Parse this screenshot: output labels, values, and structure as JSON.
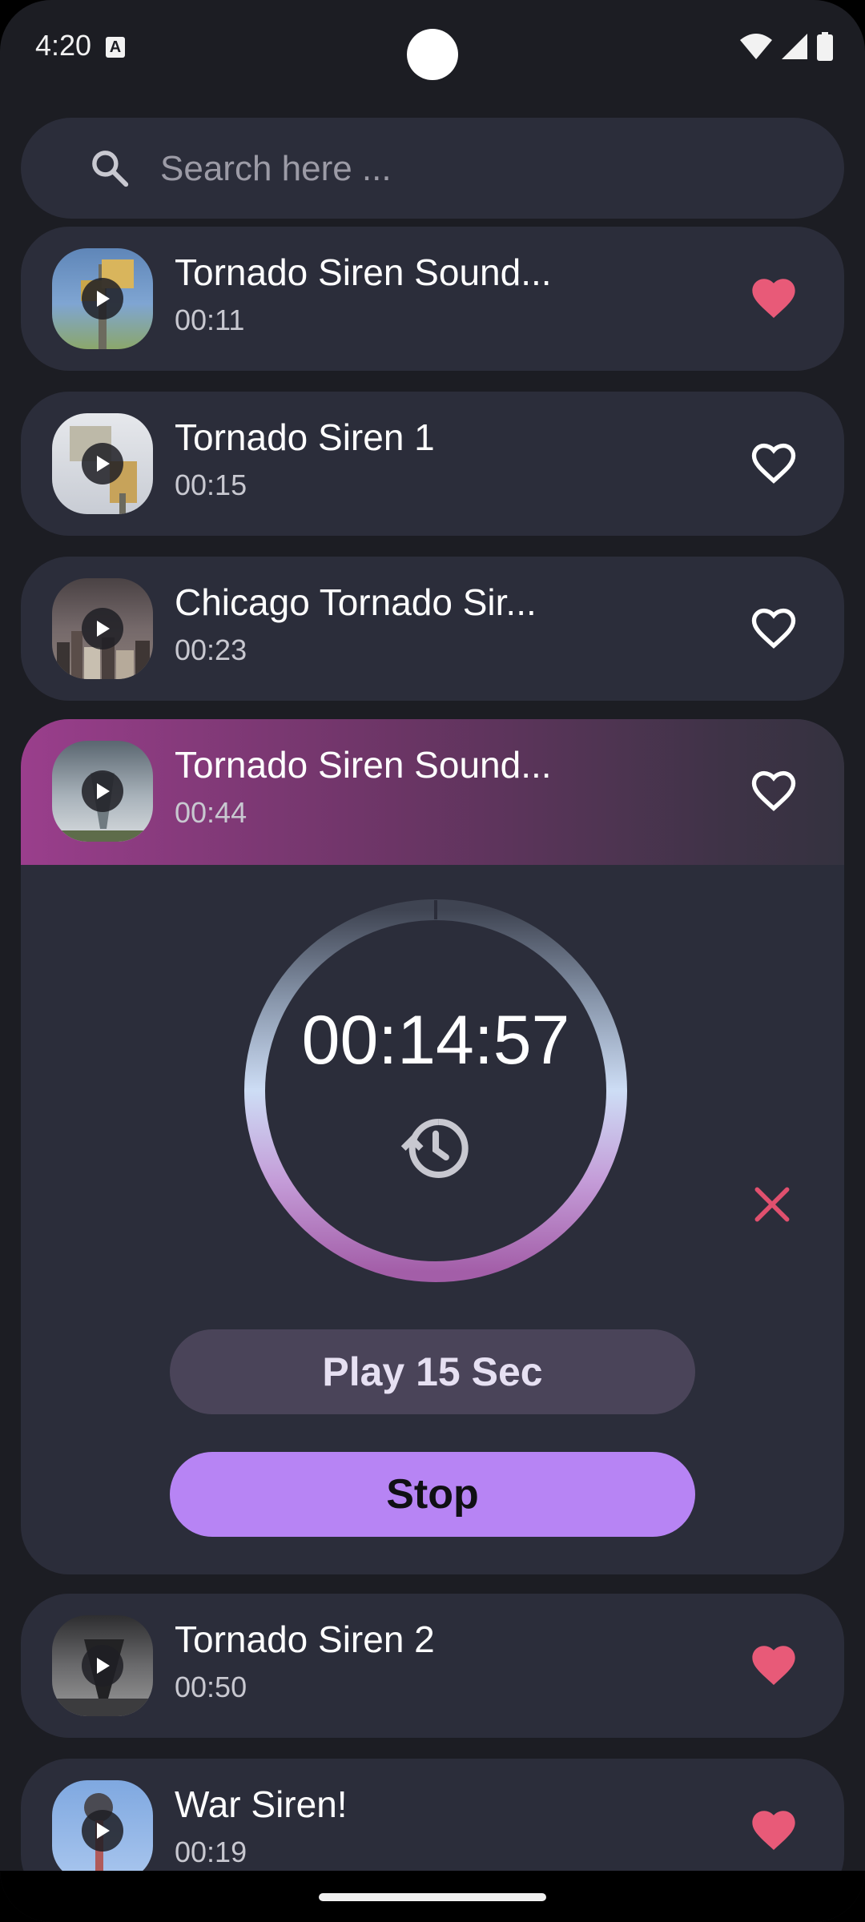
{
  "status_bar": {
    "time": "4:20",
    "notification_icon": "a-icon"
  },
  "search": {
    "placeholder": "Search here ..."
  },
  "sounds": [
    {
      "title": "Tornado Siren Sound...",
      "duration": "00:11",
      "favorite": true,
      "thumb": "siren-pole"
    },
    {
      "title": "Tornado Siren 1",
      "duration": "00:15",
      "favorite": false,
      "thumb": "siren-horn"
    },
    {
      "title": "Chicago Tornado Sir...",
      "duration": "00:23",
      "favorite": false,
      "thumb": "city-storm"
    },
    {
      "title": "Tornado Siren Sound...",
      "duration": "00:44",
      "favorite": false,
      "thumb": "tornado-field"
    },
    {
      "title": "Tornado Siren 2",
      "duration": "00:50",
      "favorite": true,
      "thumb": "tornado-dark"
    },
    {
      "title": "War Siren!",
      "duration": "00:19",
      "favorite": true,
      "thumb": "war-siren"
    }
  ],
  "player": {
    "timer": "00:14:57",
    "play_label": "Play 15 Sec",
    "stop_label": "Stop",
    "progress_fraction": 0.99
  },
  "colors": {
    "background": "#1c1d23",
    "card": "#2b2d3a",
    "heart_filled": "#e85a78",
    "accent": "#b784f4",
    "close": "#e0506e"
  }
}
